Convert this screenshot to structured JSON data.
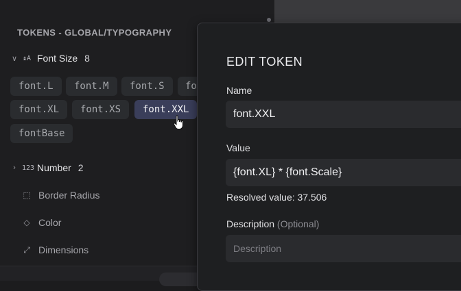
{
  "sidebar": {
    "section_title": "TOKENS - GLOBAL/TYPOGRAPHY",
    "font_size": {
      "chevron": "∨",
      "icon": "↨A",
      "label": "Font Size",
      "count": "8",
      "tokens": [
        "font.L",
        "font.M",
        "font.S",
        "fo",
        "font.XL",
        "font.XS",
        "font.XXL",
        "fontBase"
      ],
      "active_token": "font.XXL"
    },
    "number": {
      "chevron": "›",
      "icon": "123",
      "label": "Number",
      "count": "2"
    },
    "categories": [
      {
        "icon": "⬚",
        "label": "Border Radius"
      },
      {
        "icon": "◇",
        "label": "Color"
      },
      {
        "icon": "⤢",
        "label": "Dimensions"
      }
    ]
  },
  "modal": {
    "title": "EDIT TOKEN",
    "name_label": "Name",
    "name_value": "font.XXL",
    "value_label": "Value",
    "value_value": "{font.XL} * {font.Scale}",
    "resolved_value": "Resolved value: 37.506",
    "description_label": "Description",
    "description_optional": "(Optional)",
    "description_placeholder": "Description"
  }
}
